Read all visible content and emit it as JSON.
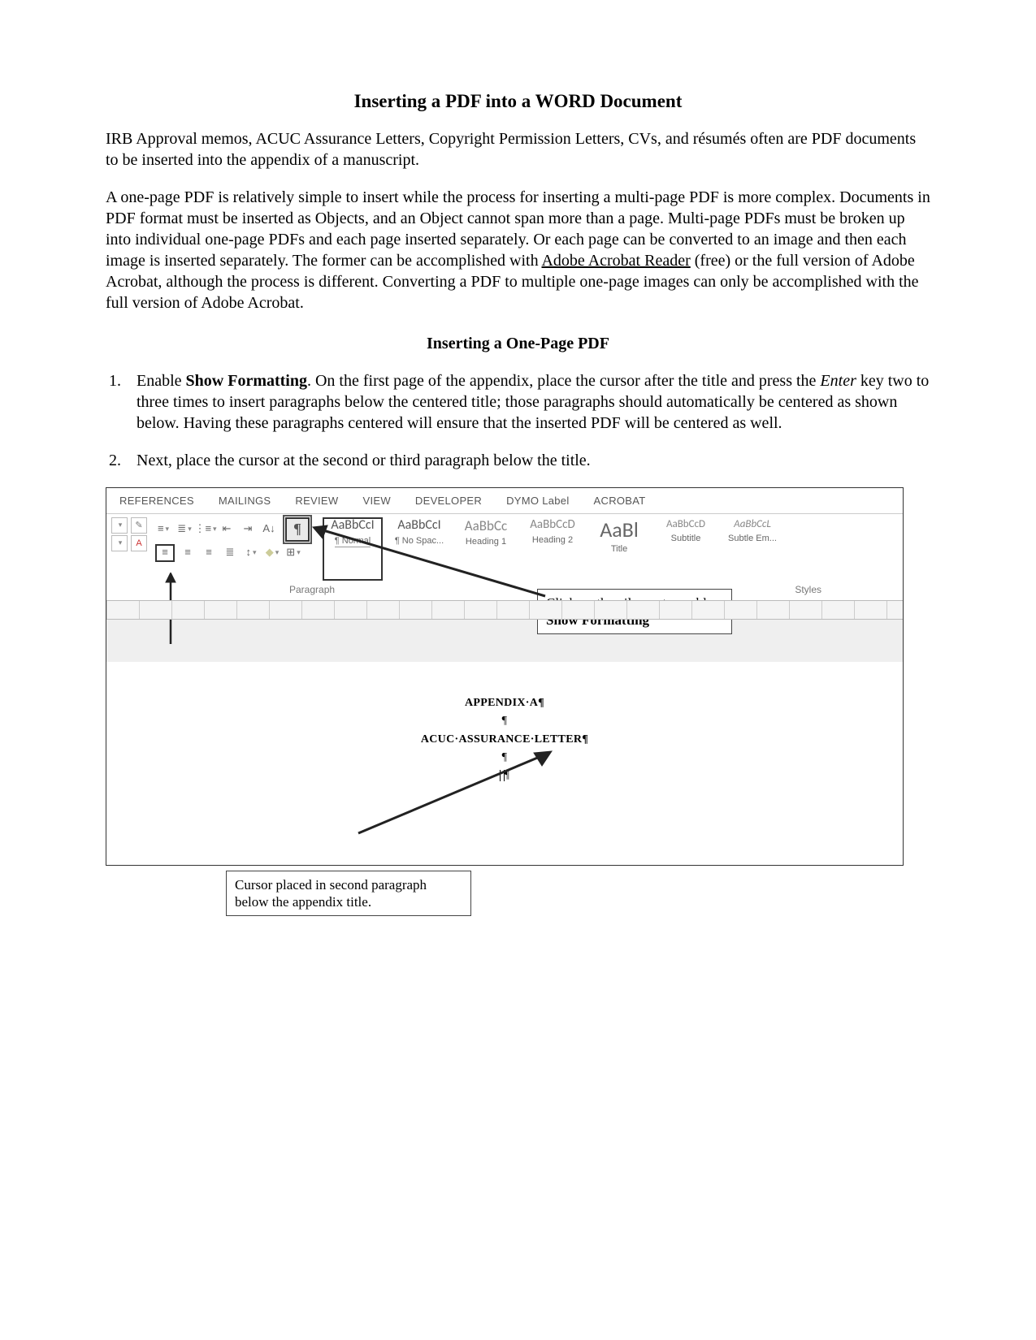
{
  "title": "Inserting a PDF into a WORD Document",
  "intro1": "IRB Approval memos, ACUC Assurance Letters, Copyright Permission Letters, CVs, and résumés often are PDF documents to be inserted into the appendix of a manuscript.",
  "intro2_pre": "A one-page PDF is relatively simple to insert while the process for inserting a multi-page PDF is more complex. Documents in PDF format must be inserted as Objects, and an Object cannot span more than a page. Multi-page PDFs must be broken up into individual one-page PDFs and each page inserted separately. Or each page can be converted to an image and then each image is inserted separately. The former can be accomplished with ",
  "intro2_link": "Adobe Acrobat Reader",
  "intro2_post": " (free) or the full version of Adobe Acrobat, although the process is different. Converting a PDF to multiple one-page images can only be accomplished with the full version of Adobe Acrobat.",
  "subtitle": "Inserting a One-Page PDF",
  "step1_pre": "Enable ",
  "step1_bold": "Show Formatting",
  "step1_post": ". On the first page of the appendix, place the cursor after the title and press the ",
  "step1_italic": "Enter",
  "step1_tail": " key two to three times to insert paragraphs below the centered title; those paragraphs should automatically be centered as shown below. Having these paragraphs centered will ensure that the inserted PDF will be centered as well.",
  "step2": "Next, place the cursor at the second or third paragraph below the title.",
  "ribbon": {
    "tabs": [
      "REFERENCES",
      "MAILINGS",
      "REVIEW",
      "VIEW",
      "DEVELOPER",
      "DYMO Label",
      "ACROBAT"
    ],
    "paragraph_label": "Paragraph",
    "styles_label": "Styles",
    "pilcrow": "¶",
    "styles": [
      {
        "sample": "AaBbCcI",
        "size": "16px",
        "name": "¶ Normal",
        "selected": true,
        "italic": false
      },
      {
        "sample": "AaBbCcI",
        "size": "16px",
        "name": "¶ No Spac...",
        "selected": false,
        "italic": false
      },
      {
        "sample": "AaBbCc",
        "size": "17px",
        "name": "Heading 1",
        "selected": false,
        "italic": false,
        "color": "#888"
      },
      {
        "sample": "AaBbCcD",
        "size": "15px",
        "name": "Heading 2",
        "selected": false,
        "italic": false,
        "color": "#888"
      },
      {
        "sample": "AaBl",
        "size": "26px",
        "name": "Title",
        "selected": false,
        "italic": false,
        "color": "#666"
      },
      {
        "sample": "AaBbCcD",
        "size": "13px",
        "name": "Subtitle",
        "selected": false,
        "italic": false,
        "color": "#888"
      },
      {
        "sample": "AaBbCcL",
        "size": "13px",
        "name": "Subtle Em...",
        "selected": false,
        "italic": true,
        "color": "#888"
      }
    ]
  },
  "doc": {
    "line1": "APPENDIX·A¶",
    "pilcrow": "¶",
    "line2": "ACUC·ASSURANCE·LETTER¶"
  },
  "callout1_pre": "Click on the pilcrow to enable ",
  "callout1_bold": "Show Formatting",
  "callout2": "Cursor placed in second paragraph below the appendix title."
}
